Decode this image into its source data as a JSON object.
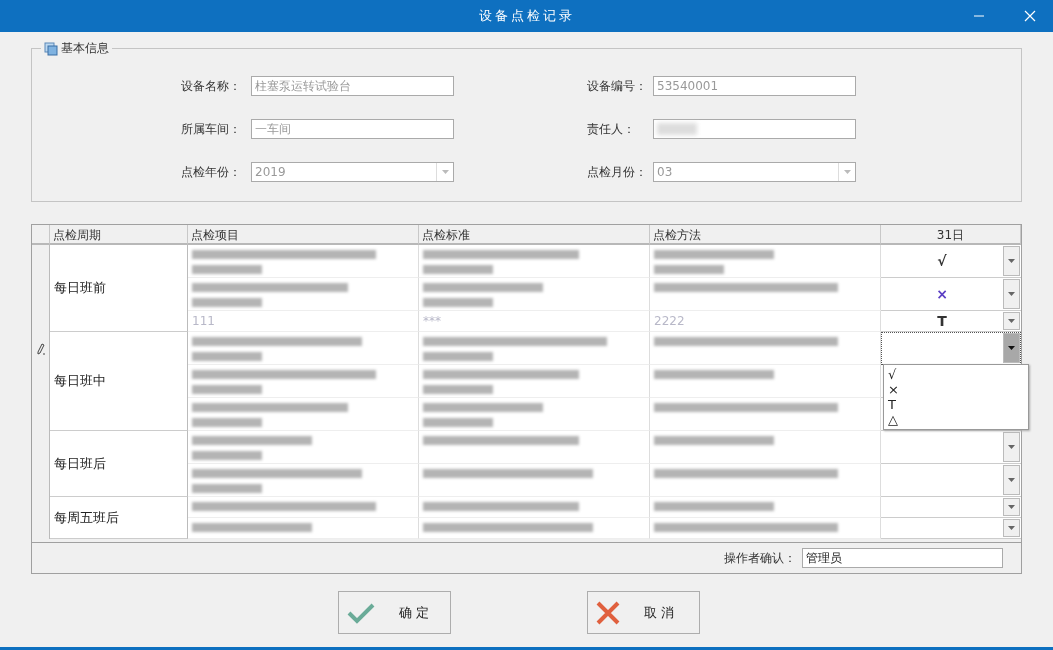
{
  "window": {
    "title": "设备点检记录"
  },
  "basic_info": {
    "title": "基本信息",
    "fields": [
      {
        "label": "设备名称：",
        "value": "柱塞泵运转试验台",
        "kind": "text"
      },
      {
        "label": "设备编号：",
        "value": "53540001",
        "kind": "text"
      },
      {
        "label": "所属车间：",
        "value": "一车间",
        "kind": "text"
      },
      {
        "label": "责任人：",
        "kind": "blurred"
      },
      {
        "label": "点检年份：",
        "value": "2019",
        "kind": "combo"
      },
      {
        "label": "点检月份：",
        "value": "03",
        "kind": "combo"
      }
    ]
  },
  "table": {
    "columns": [
      "点检周期",
      "点检项目",
      "点检标准",
      "点检方法",
      "31日"
    ],
    "dropdown_options": [
      "√",
      "×",
      "T",
      "△"
    ],
    "groups": [
      {
        "period": "每日班前",
        "rows": [
          {
            "selected": false,
            "expanded": false,
            "item": {
              "kind": "blurred2"
            },
            "standard": {
              "kind": "blurred2"
            },
            "method": {
              "kind": "blurred2"
            },
            "day": {
              "value": "√",
              "color": "#333333"
            }
          },
          {
            "selected": false,
            "expanded": false,
            "item": {
              "kind": "blurred2"
            },
            "standard": {
              "kind": "blurred2"
            },
            "method": {
              "kind": "blurred1"
            },
            "day": {
              "value": "×",
              "color": "#5b3fc4"
            }
          },
          {
            "selected": false,
            "expanded": false,
            "item": {
              "kind": "text",
              "text": "111"
            },
            "standard": {
              "kind": "text",
              "text": "***"
            },
            "method": {
              "kind": "text",
              "text": "2222"
            },
            "day": {
              "value": "T",
              "color": "#333333"
            }
          }
        ]
      },
      {
        "period": "每日班中",
        "rows": [
          {
            "selected": true,
            "expanded": true,
            "item": {
              "kind": "blurred2"
            },
            "standard": {
              "kind": "blurred2"
            },
            "method": {
              "kind": "blurred1"
            },
            "day": {}
          },
          {
            "selected": false,
            "expanded": false,
            "item": {
              "kind": "blurred2"
            },
            "standard": {
              "kind": "blurred2"
            },
            "method": {
              "kind": "blurred1"
            },
            "day": {}
          },
          {
            "selected": false,
            "expanded": false,
            "item": {
              "kind": "blurred2"
            },
            "standard": {
              "kind": "blurred2"
            },
            "method": {
              "kind": "blurred1"
            },
            "day": {}
          }
        ]
      },
      {
        "period": "每日班后",
        "rows": [
          {
            "selected": false,
            "expanded": false,
            "item": {
              "kind": "blurred2"
            },
            "standard": {
              "kind": "blurred1"
            },
            "method": {
              "kind": "blurred1"
            },
            "day": {}
          },
          {
            "selected": false,
            "expanded": false,
            "item": {
              "kind": "blurred2"
            },
            "standard": {
              "kind": "blurred1"
            },
            "method": {
              "kind": "blurred1"
            },
            "day": {}
          }
        ]
      },
      {
        "period": "每周五班后",
        "rows": [
          {
            "selected": false,
            "expanded": false,
            "item": {
              "kind": "blurred1"
            },
            "standard": {
              "kind": "blurred1"
            },
            "method": {
              "kind": "blurred1"
            },
            "day": {}
          },
          {
            "selected": false,
            "expanded": false,
            "item": {
              "kind": "blurred1"
            },
            "standard": {
              "kind": "blurred1"
            },
            "method": {
              "kind": "blurred1"
            },
            "day": {}
          }
        ]
      }
    ]
  },
  "operator": {
    "label": "操作者确认：",
    "value": "管理员"
  },
  "buttons": [
    {
      "label": "确 定",
      "kind": "ok"
    },
    {
      "label": "取 消",
      "kind": "cancel"
    }
  ]
}
